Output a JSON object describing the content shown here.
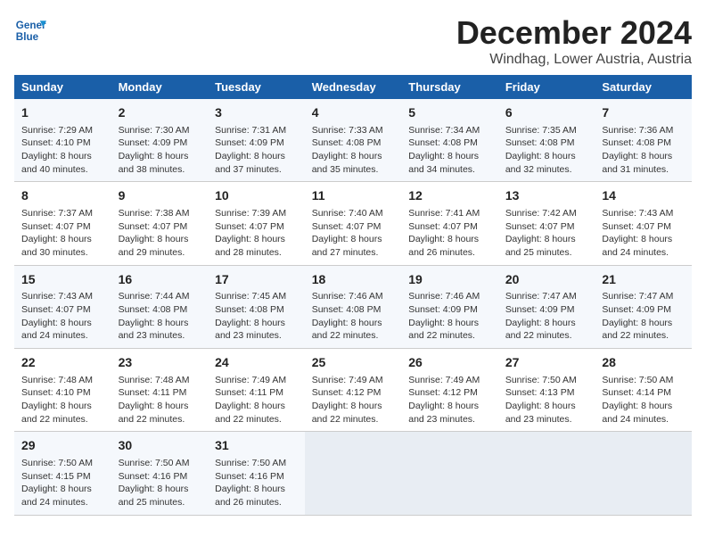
{
  "logo": {
    "line1": "General",
    "line2": "Blue"
  },
  "title": "December 2024",
  "location": "Windhag, Lower Austria, Austria",
  "days_of_week": [
    "Sunday",
    "Monday",
    "Tuesday",
    "Wednesday",
    "Thursday",
    "Friday",
    "Saturday"
  ],
  "weeks": [
    [
      {
        "day": "1",
        "sunrise": "Sunrise: 7:29 AM",
        "sunset": "Sunset: 4:10 PM",
        "daylight": "Daylight: 8 hours and 40 minutes."
      },
      {
        "day": "2",
        "sunrise": "Sunrise: 7:30 AM",
        "sunset": "Sunset: 4:09 PM",
        "daylight": "Daylight: 8 hours and 38 minutes."
      },
      {
        "day": "3",
        "sunrise": "Sunrise: 7:31 AM",
        "sunset": "Sunset: 4:09 PM",
        "daylight": "Daylight: 8 hours and 37 minutes."
      },
      {
        "day": "4",
        "sunrise": "Sunrise: 7:33 AM",
        "sunset": "Sunset: 4:08 PM",
        "daylight": "Daylight: 8 hours and 35 minutes."
      },
      {
        "day": "5",
        "sunrise": "Sunrise: 7:34 AM",
        "sunset": "Sunset: 4:08 PM",
        "daylight": "Daylight: 8 hours and 34 minutes."
      },
      {
        "day": "6",
        "sunrise": "Sunrise: 7:35 AM",
        "sunset": "Sunset: 4:08 PM",
        "daylight": "Daylight: 8 hours and 32 minutes."
      },
      {
        "day": "7",
        "sunrise": "Sunrise: 7:36 AM",
        "sunset": "Sunset: 4:08 PM",
        "daylight": "Daylight: 8 hours and 31 minutes."
      }
    ],
    [
      {
        "day": "8",
        "sunrise": "Sunrise: 7:37 AM",
        "sunset": "Sunset: 4:07 PM",
        "daylight": "Daylight: 8 hours and 30 minutes."
      },
      {
        "day": "9",
        "sunrise": "Sunrise: 7:38 AM",
        "sunset": "Sunset: 4:07 PM",
        "daylight": "Daylight: 8 hours and 29 minutes."
      },
      {
        "day": "10",
        "sunrise": "Sunrise: 7:39 AM",
        "sunset": "Sunset: 4:07 PM",
        "daylight": "Daylight: 8 hours and 28 minutes."
      },
      {
        "day": "11",
        "sunrise": "Sunrise: 7:40 AM",
        "sunset": "Sunset: 4:07 PM",
        "daylight": "Daylight: 8 hours and 27 minutes."
      },
      {
        "day": "12",
        "sunrise": "Sunrise: 7:41 AM",
        "sunset": "Sunset: 4:07 PM",
        "daylight": "Daylight: 8 hours and 26 minutes."
      },
      {
        "day": "13",
        "sunrise": "Sunrise: 7:42 AM",
        "sunset": "Sunset: 4:07 PM",
        "daylight": "Daylight: 8 hours and 25 minutes."
      },
      {
        "day": "14",
        "sunrise": "Sunrise: 7:43 AM",
        "sunset": "Sunset: 4:07 PM",
        "daylight": "Daylight: 8 hours and 24 minutes."
      }
    ],
    [
      {
        "day": "15",
        "sunrise": "Sunrise: 7:43 AM",
        "sunset": "Sunset: 4:07 PM",
        "daylight": "Daylight: 8 hours and 24 minutes."
      },
      {
        "day": "16",
        "sunrise": "Sunrise: 7:44 AM",
        "sunset": "Sunset: 4:08 PM",
        "daylight": "Daylight: 8 hours and 23 minutes."
      },
      {
        "day": "17",
        "sunrise": "Sunrise: 7:45 AM",
        "sunset": "Sunset: 4:08 PM",
        "daylight": "Daylight: 8 hours and 23 minutes."
      },
      {
        "day": "18",
        "sunrise": "Sunrise: 7:46 AM",
        "sunset": "Sunset: 4:08 PM",
        "daylight": "Daylight: 8 hours and 22 minutes."
      },
      {
        "day": "19",
        "sunrise": "Sunrise: 7:46 AM",
        "sunset": "Sunset: 4:09 PM",
        "daylight": "Daylight: 8 hours and 22 minutes."
      },
      {
        "day": "20",
        "sunrise": "Sunrise: 7:47 AM",
        "sunset": "Sunset: 4:09 PM",
        "daylight": "Daylight: 8 hours and 22 minutes."
      },
      {
        "day": "21",
        "sunrise": "Sunrise: 7:47 AM",
        "sunset": "Sunset: 4:09 PM",
        "daylight": "Daylight: 8 hours and 22 minutes."
      }
    ],
    [
      {
        "day": "22",
        "sunrise": "Sunrise: 7:48 AM",
        "sunset": "Sunset: 4:10 PM",
        "daylight": "Daylight: 8 hours and 22 minutes."
      },
      {
        "day": "23",
        "sunrise": "Sunrise: 7:48 AM",
        "sunset": "Sunset: 4:11 PM",
        "daylight": "Daylight: 8 hours and 22 minutes."
      },
      {
        "day": "24",
        "sunrise": "Sunrise: 7:49 AM",
        "sunset": "Sunset: 4:11 PM",
        "daylight": "Daylight: 8 hours and 22 minutes."
      },
      {
        "day": "25",
        "sunrise": "Sunrise: 7:49 AM",
        "sunset": "Sunset: 4:12 PM",
        "daylight": "Daylight: 8 hours and 22 minutes."
      },
      {
        "day": "26",
        "sunrise": "Sunrise: 7:49 AM",
        "sunset": "Sunset: 4:12 PM",
        "daylight": "Daylight: 8 hours and 23 minutes."
      },
      {
        "day": "27",
        "sunrise": "Sunrise: 7:50 AM",
        "sunset": "Sunset: 4:13 PM",
        "daylight": "Daylight: 8 hours and 23 minutes."
      },
      {
        "day": "28",
        "sunrise": "Sunrise: 7:50 AM",
        "sunset": "Sunset: 4:14 PM",
        "daylight": "Daylight: 8 hours and 24 minutes."
      }
    ],
    [
      {
        "day": "29",
        "sunrise": "Sunrise: 7:50 AM",
        "sunset": "Sunset: 4:15 PM",
        "daylight": "Daylight: 8 hours and 24 minutes."
      },
      {
        "day": "30",
        "sunrise": "Sunrise: 7:50 AM",
        "sunset": "Sunset: 4:16 PM",
        "daylight": "Daylight: 8 hours and 25 minutes."
      },
      {
        "day": "31",
        "sunrise": "Sunrise: 7:50 AM",
        "sunset": "Sunset: 4:16 PM",
        "daylight": "Daylight: 8 hours and 26 minutes."
      },
      null,
      null,
      null,
      null
    ]
  ]
}
